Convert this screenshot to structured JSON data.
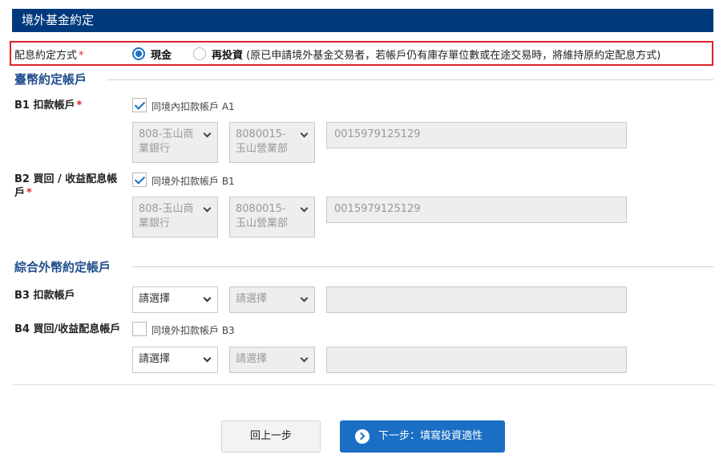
{
  "header": {
    "title": "境外基金約定"
  },
  "distribution": {
    "label": "配息約定方式",
    "required_mark": "*",
    "options": [
      {
        "label": "現金",
        "note": "",
        "selected": true
      },
      {
        "label": "再投資",
        "note": "(原已申請境外基金交易者，若帳戶仍有庫存單位數或在途交易時，將維持原約定配息方式)",
        "selected": false
      }
    ]
  },
  "twd_section": {
    "title": "臺幣約定帳戶",
    "b1": {
      "label": "B1 扣款帳戶",
      "required_mark": "*",
      "checkbox_label": "同境內扣款帳戶 A1",
      "checked": true,
      "bank": "808-玉山商業銀行",
      "branch": "8080015-玉山營業部",
      "account": "0015979125129"
    },
    "b2": {
      "label": "B2 買回 / 收益配息帳戶",
      "required_mark": "*",
      "checkbox_label": "同境外扣款帳戶 B1",
      "checked": true,
      "bank": "808-玉山商業銀行",
      "branch": "8080015-玉山營業部",
      "account": "0015979125129"
    }
  },
  "fx_section": {
    "title": "綜合外幣約定帳戶",
    "b3": {
      "label": "B3 扣款帳戶",
      "bank_placeholder": "請選擇",
      "branch_placeholder": "請選擇",
      "account": ""
    },
    "b4": {
      "label": "B4 買回/收益配息帳戶",
      "checkbox_label": "同境外扣款帳戶 B3",
      "checked": false,
      "bank_placeholder": "請選擇",
      "branch_placeholder": "請選擇",
      "account": ""
    }
  },
  "actions": {
    "prev_label": "回上一步",
    "next_label": "下一步：填寫投資適性",
    "next_icon": "chevron-right-circle-icon"
  },
  "colors": {
    "header_bg": "#003a7d",
    "accent": "#1a73c8",
    "highlight_border": "#d9252b",
    "section_title": "#1f4e8c",
    "primary_button": "#1a6fc4"
  }
}
